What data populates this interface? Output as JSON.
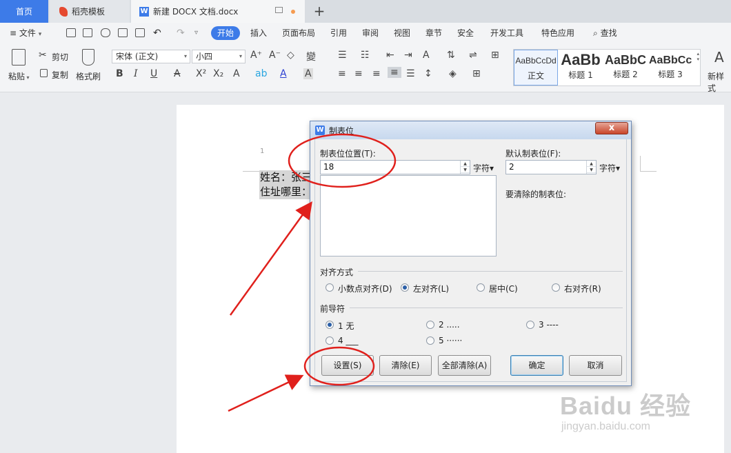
{
  "tabs": {
    "home": "首页",
    "daoke": "稻壳模板",
    "document": "新建 DOCX 文档.docx",
    "new_tab": "+"
  },
  "menu": {
    "file": "文件",
    "items": [
      "开始",
      "插入",
      "页面布局",
      "引用",
      "审阅",
      "视图",
      "章节",
      "安全",
      "开发工具",
      "特色应用"
    ],
    "search": "查找"
  },
  "ribbon": {
    "paste": "粘贴",
    "cut": "剪切",
    "copy": "复制",
    "format_painter": "格式刷",
    "font_name": "宋体 (正文)",
    "font_size": "小四",
    "styles": [
      {
        "sample": "AaBbCcDd",
        "name": "正文"
      },
      {
        "sample": "AaBb",
        "name": "标题 1"
      },
      {
        "sample": "AaBbC",
        "name": "标题 2"
      },
      {
        "sample": "AaBbCc",
        "name": "标题 3"
      }
    ],
    "new_style": "新样式"
  },
  "document": {
    "page_number": "1",
    "line1": "姓名：张三",
    "line2": "住址哪里："
  },
  "dialog": {
    "title": "制表位",
    "tab_position_label": "制表位位置(T):",
    "tab_position_value": "18",
    "unit_char": "字符▾",
    "default_tab_label": "默认制表位(F):",
    "default_tab_value": "2",
    "clear_tabs_label": "要清除的制表位:",
    "alignment_label": "对齐方式",
    "alignment_options": [
      "小数点对齐(D)",
      "左对齐(L)",
      "居中(C)",
      "右对齐(R)"
    ],
    "alignment_selected": "左对齐(L)",
    "leader_label": "前导符",
    "leader_options": [
      "1 无",
      "2 .....",
      "3 ----",
      "4 ___",
      "5 ······"
    ],
    "leader_selected": "1 无",
    "btn_set": "设置(S)",
    "btn_clear": "清除(E)",
    "btn_clear_all": "全部清除(A)",
    "btn_ok": "确定",
    "btn_cancel": "取消",
    "close_symbol": "x"
  },
  "watermark": {
    "main": "Baidu 经验",
    "sub": "jingyan.baidu.com"
  },
  "colors": {
    "accent": "#3d7be8",
    "annotation_red": "#e0201c"
  }
}
